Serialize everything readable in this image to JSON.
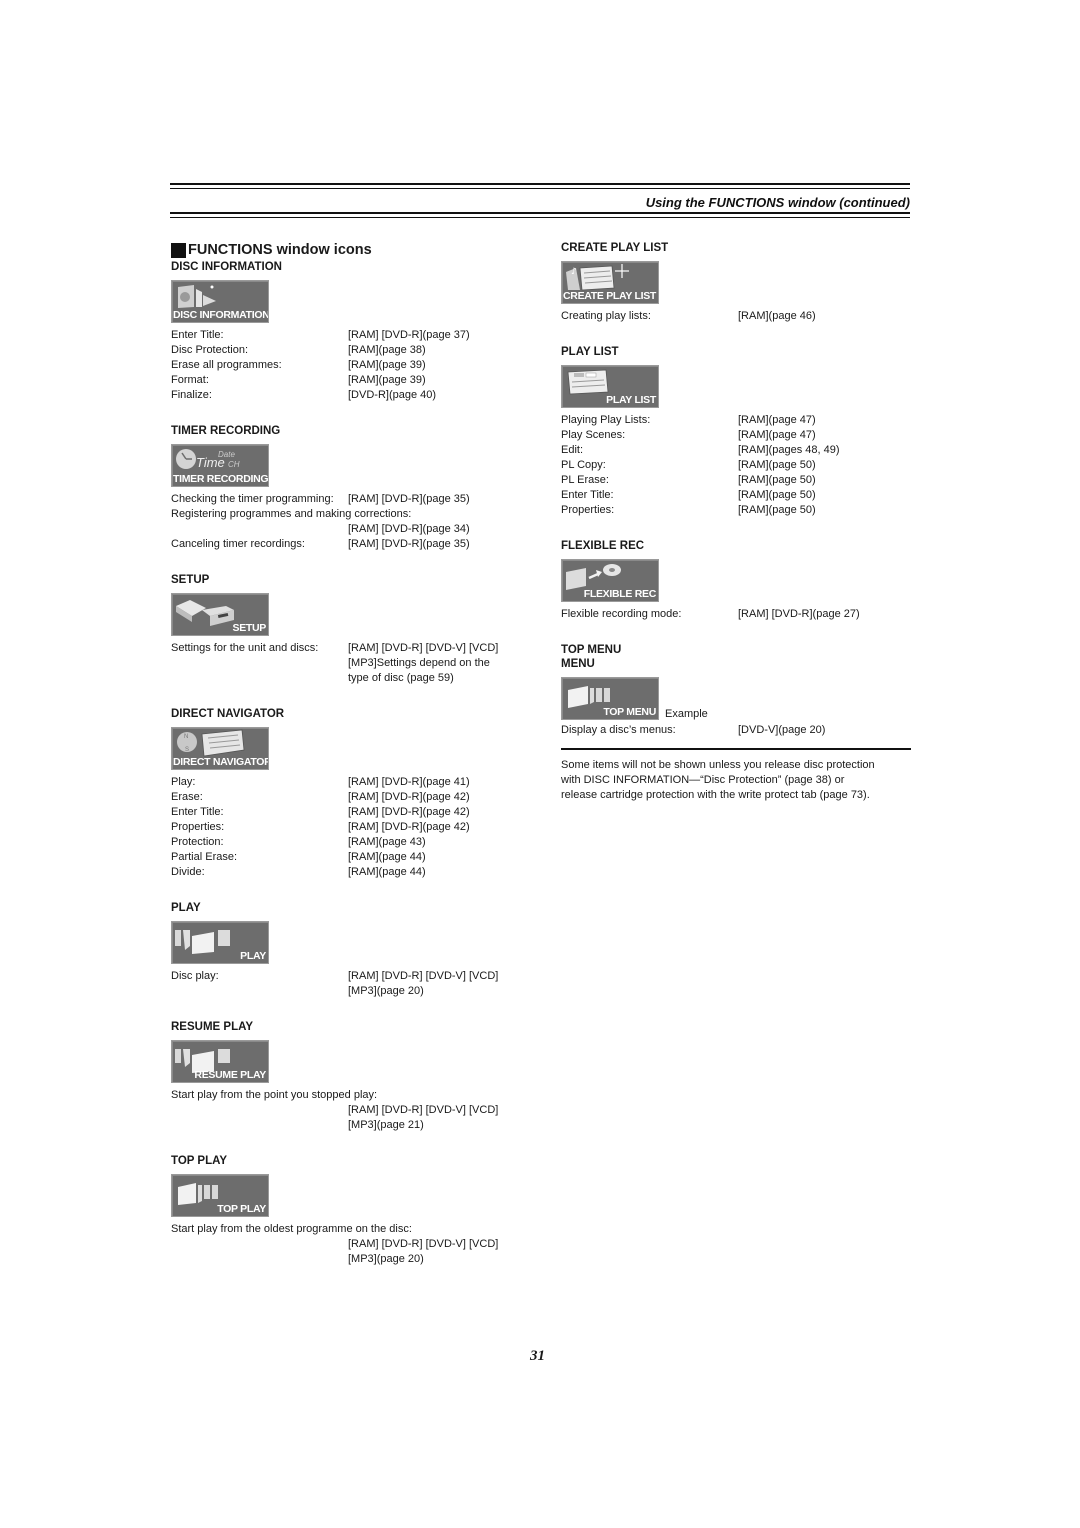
{
  "header": {
    "title": "Using the FUNCTIONS window (continued)"
  },
  "main_heading": "FUNCTIONS window icons",
  "left_sections": [
    {
      "title": "DISC INFORMATION",
      "icon_label": "DISC INFORMATION",
      "icon": "disc-information-icon",
      "rows": [
        {
          "k": "Enter Title:",
          "v": "[RAM] [DVD-R](page 37)"
        },
        {
          "k": "Disc Protection:",
          "v": "[RAM](page 38)"
        },
        {
          "k": "Erase all programmes:",
          "v": "[RAM](page 39)"
        },
        {
          "k": "Format:",
          "v": "[RAM](page 39)"
        },
        {
          "k": "Finalize:",
          "v": "[DVD-R](page 40)"
        }
      ]
    },
    {
      "title": "TIMER RECORDING",
      "icon_label": "TIMER RECORDING",
      "icon": "timer-recording-icon",
      "icon_art": {
        "word1": "Time",
        "word2": "Date",
        "word3": "CH"
      },
      "rows": [
        {
          "k": "Checking the timer programming:",
          "v": "[RAM] [DVD-R](page 35)"
        },
        {
          "full": "Registering programmes and making corrections:"
        },
        {
          "indent": "[RAM] [DVD-R](page 34)"
        },
        {
          "k": "Canceling timer recordings:",
          "v": "[RAM] [DVD-R](page 35)"
        }
      ]
    },
    {
      "title": "SETUP",
      "icon_label": "SETUP",
      "icon": "setup-icon",
      "rows": [
        {
          "k": "Settings for the unit and discs:",
          "v": "[RAM] [DVD-R] [DVD-V] [VCD]"
        },
        {
          "indent": "[MP3]Settings depend on the"
        },
        {
          "indent": "type of disc (page 59)"
        }
      ]
    },
    {
      "title": "DIRECT NAVIGATOR",
      "icon_label": "DIRECT NAVIGATOR",
      "icon": "direct-navigator-icon",
      "icon_art": {
        "north": "N",
        "south": "S"
      },
      "rows": [
        {
          "k": "Play:",
          "v": "[RAM] [DVD-R](page 41)"
        },
        {
          "k": "Erase:",
          "v": "[RAM] [DVD-R](page 42)"
        },
        {
          "k": "Enter Title:",
          "v": "[RAM] [DVD-R](page 42)"
        },
        {
          "k": "Properties:",
          "v": "[RAM] [DVD-R](page 42)"
        },
        {
          "k": "Protection:",
          "v": "[RAM](page 43)"
        },
        {
          "k": "Partial Erase:",
          "v": "[RAM](page 44)"
        },
        {
          "k": "Divide:",
          "v": "[RAM](page 44)"
        }
      ]
    },
    {
      "title": "PLAY",
      "icon_label": "PLAY",
      "icon": "play-icon",
      "rows": [
        {
          "k": "Disc play:",
          "v": "[RAM] [DVD-R] [DVD-V] [VCD]"
        },
        {
          "indent": "[MP3](page 20)"
        }
      ]
    },
    {
      "title": "RESUME PLAY",
      "icon_label": "RESUME PLAY",
      "icon": "resume-play-icon",
      "rows": [
        {
          "full": "Start play from the point you stopped play:"
        },
        {
          "indent": "[RAM] [DVD-R] [DVD-V] [VCD]"
        },
        {
          "indent": "[MP3](page 21)"
        }
      ]
    },
    {
      "title": "TOP PLAY",
      "icon_label": "TOP PLAY",
      "icon": "top-play-icon",
      "rows": [
        {
          "full": "Start play from the oldest programme on the disc:"
        },
        {
          "indent": "[RAM] [DVD-R] [DVD-V] [VCD]"
        },
        {
          "indent": "[MP3](page 20)"
        }
      ]
    }
  ],
  "right_sections": [
    {
      "title": "CREATE PLAY LIST",
      "icon_label": "CREATE PLAY LIST",
      "icon": "create-play-list-icon",
      "rows": [
        {
          "k": "Creating play lists:",
          "v": "[RAM](page 46)"
        }
      ]
    },
    {
      "title": "PLAY LIST",
      "icon_label": "PLAY LIST",
      "icon": "play-list-icon",
      "rows": [
        {
          "k": "Playing Play Lists:",
          "v": "[RAM](page 47)"
        },
        {
          "k": "Play Scenes:",
          "v": "[RAM](page 47)"
        },
        {
          "k": "Edit:",
          "v": "[RAM](pages 48, 49)"
        },
        {
          "k": "PL Copy:",
          "v": "[RAM](page 50)"
        },
        {
          "k": "PL Erase:",
          "v": "[RAM](page 50)"
        },
        {
          "k": "Enter Title:",
          "v": "[RAM](page 50)"
        },
        {
          "k": "Properties:",
          "v": "[RAM](page 50)"
        }
      ]
    },
    {
      "title": "FLEXIBLE REC",
      "icon_label": "FLEXIBLE REC",
      "icon": "flexible-rec-icon",
      "rows": [
        {
          "k": "Flexible recording mode:",
          "v": "[RAM] [DVD-R](page 27)"
        }
      ]
    },
    {
      "title": "TOP MENU",
      "title2": "MENU",
      "icon_label": "TOP MENU",
      "icon": "top-menu-icon",
      "example": "Example",
      "rows": [
        {
          "k": "Display a disc’s menus:",
          "v": "[DVD-V](page 20)"
        }
      ]
    }
  ],
  "note": "Some items will not be shown unless you release disc protection with DISC INFORMATION—“Disc Protection” (page 38) or release cartridge protection with the write protect tab (page 73).",
  "note_lines": [
    "Some items will not be shown unless you release disc protection",
    "with DISC INFORMATION—“Disc Protection” (page 38) or",
    "release cartridge protection with the write protect tab (page 73)."
  ],
  "page_number": "31",
  "colors": {
    "icon_background": "#6d6d6d",
    "icon_text": "#ffffff",
    "text": "#1a1a1a"
  }
}
